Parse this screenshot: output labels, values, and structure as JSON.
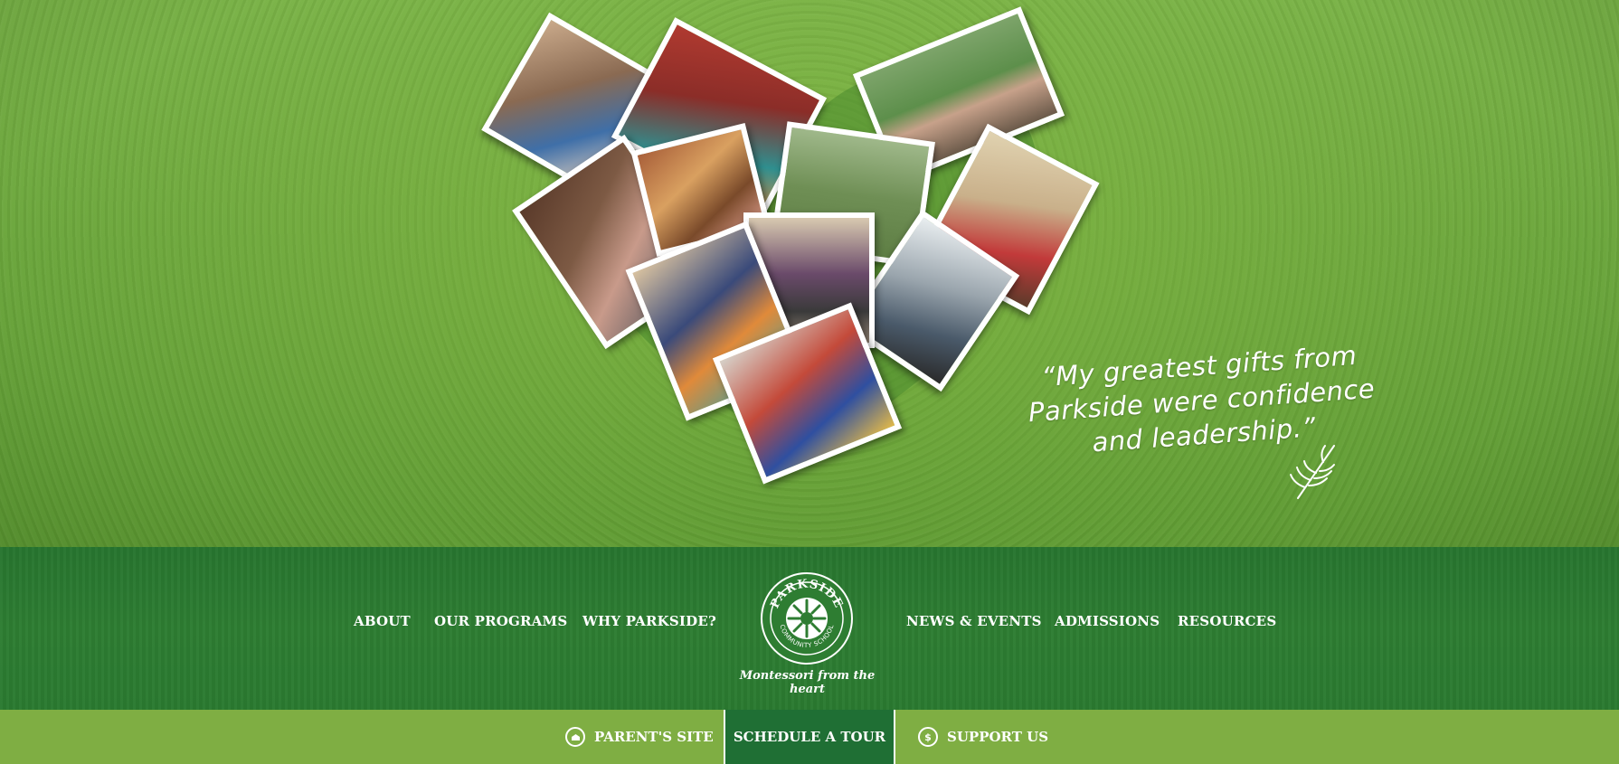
{
  "hero": {
    "quote": "“My greatest gifts from Parkside were confidence and leadership.”",
    "quote_lines": [
      "“My greatest gifts from",
      "Parkside were confidence",
      "and leadership.”"
    ],
    "photo_collage_shape": "heart"
  },
  "nav": {
    "left": [
      "ABOUT",
      "OUR PROGRAMS",
      "WHY PARKSIDE?"
    ],
    "right": [
      "NEWS & EVENTS",
      "ADMISSIONS",
      "RESOURCES"
    ]
  },
  "logo": {
    "top_text": "PARKSIDE",
    "ring_text": "COMMUNITY SCHOOL",
    "tagline": "Montessori from the heart"
  },
  "utility": {
    "parents_site": "PARENT'S SITE",
    "schedule_tour": "SCHEDULE A TOUR",
    "support_us": "SUPPORT US",
    "support_symbol": "$"
  },
  "colors": {
    "grass": "#6aa53b",
    "nav_band": "#2a7a30",
    "util_bar": "#7fae43",
    "tour_button": "#1f6f34",
    "text": "#ffffff"
  }
}
